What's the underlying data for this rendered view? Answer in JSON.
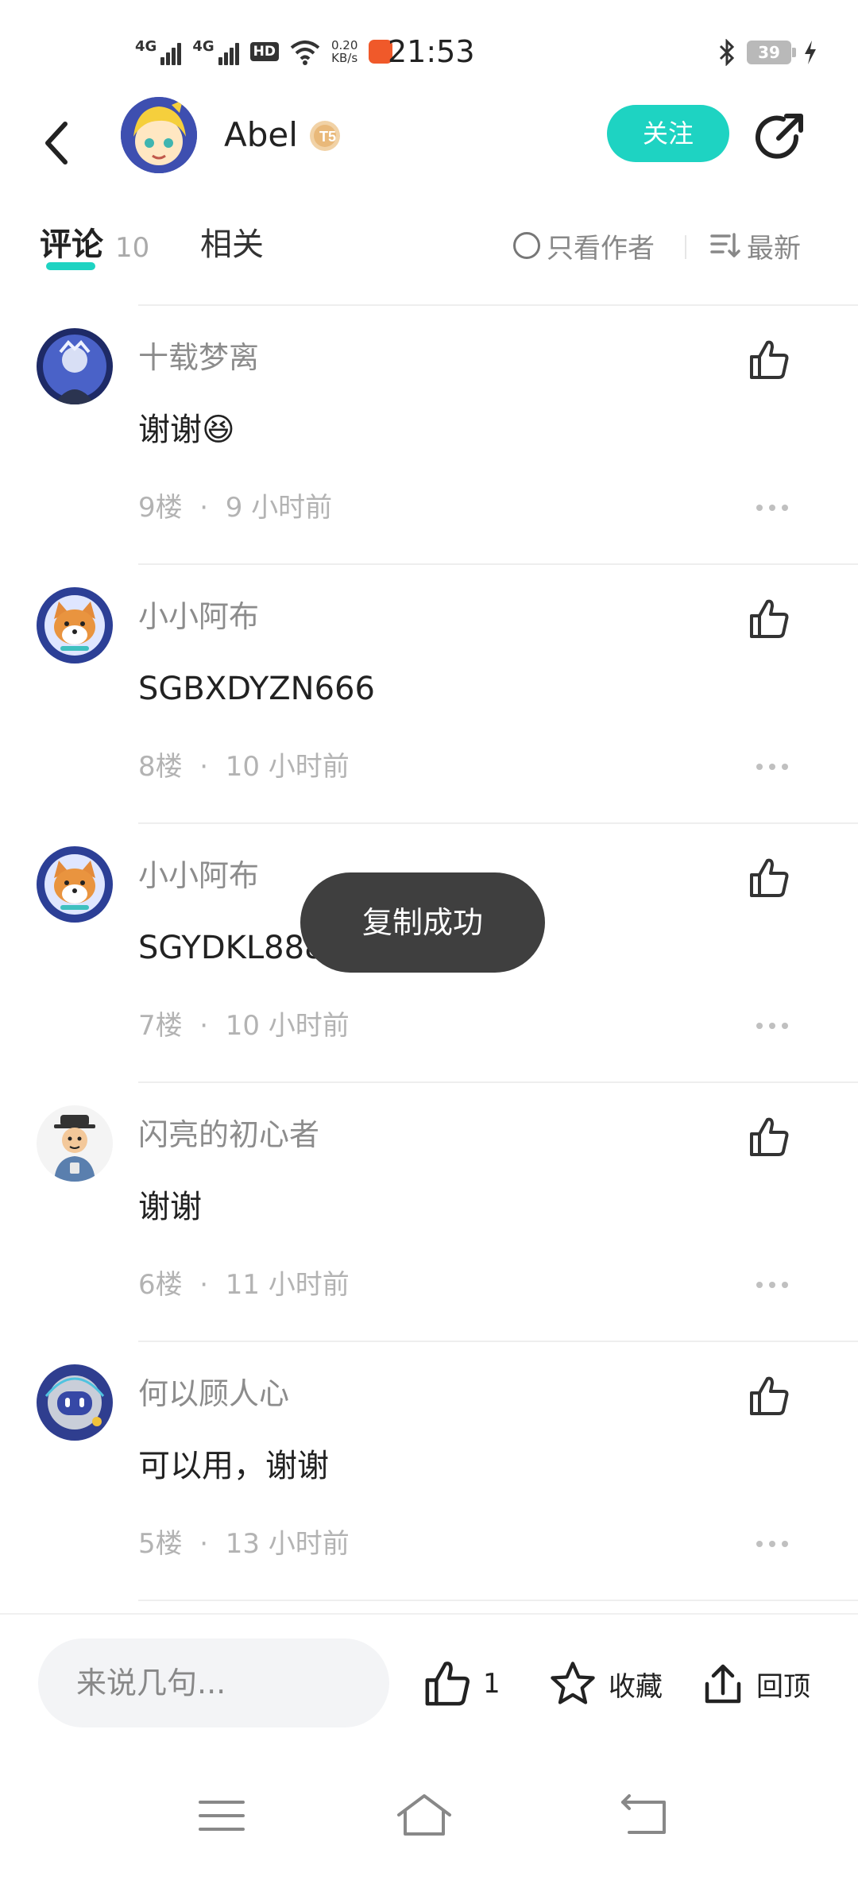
{
  "status_bar": {
    "network1": "4G",
    "network2": "4G",
    "hd": "HD",
    "speed_value": "0.20",
    "speed_unit": "KB/s",
    "time": "21:53",
    "battery": "39"
  },
  "header": {
    "author_name": "Abel",
    "level_badge": "T5",
    "follow_label": "关注"
  },
  "tabs": {
    "comments_label": "评论",
    "comments_count": "10",
    "related_label": "相关",
    "author_only_label": "只看作者",
    "sort_label": "最新"
  },
  "comments": [
    {
      "name": "十载梦离",
      "text": "谢谢",
      "emoji": "😆",
      "floor": "9楼",
      "time": "9 小时前"
    },
    {
      "name": "小小阿布",
      "text": "SGBXDYZN666",
      "floor": "8楼",
      "time": "10 小时前"
    },
    {
      "name": "小小阿布",
      "text": "SGYDKL888",
      "floor": "7楼",
      "time": "10 小时前"
    },
    {
      "name": "闪亮的初心者",
      "text": "谢谢",
      "floor": "6楼",
      "time": "11 小时前"
    },
    {
      "name": "何以顾人心",
      "text": "可以用，谢谢",
      "floor": "5楼",
      "time": "13 小时前"
    }
  ],
  "toast": "复制成功",
  "bottom_bar": {
    "input_placeholder": "来说几句...",
    "like_count": "1",
    "favorite_label": "收藏",
    "top_label": "回顶"
  },
  "meta_separator": "·",
  "colors": {
    "accent": "#1ed3c2",
    "toast_bg": "#3f3f3f",
    "muted_text": "#8c8c8c"
  }
}
